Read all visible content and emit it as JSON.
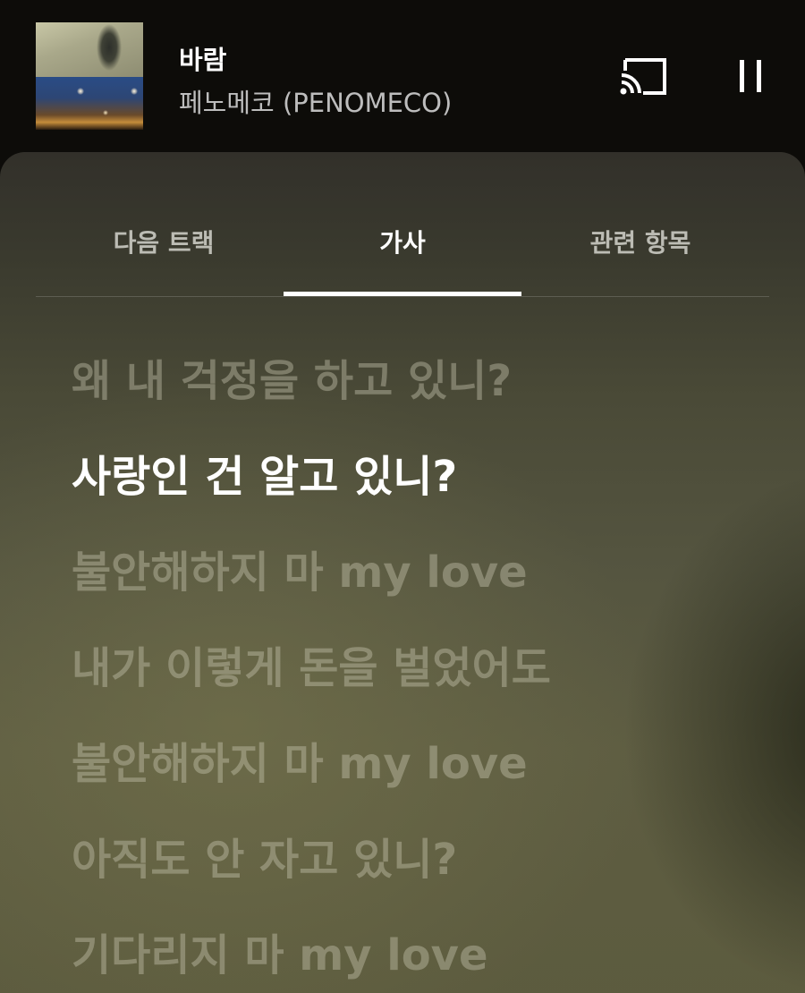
{
  "now_playing": {
    "title": "바람",
    "artist": "페노메코 (PENOMECO)"
  },
  "controls": {
    "cast_icon": "cast-icon",
    "pause_icon": "pause-icon"
  },
  "tabs": [
    {
      "label": "다음 트랙",
      "active": false
    },
    {
      "label": "가사",
      "active": true
    },
    {
      "label": "관련 항목",
      "active": false
    }
  ],
  "lyrics": {
    "current_index": 1,
    "lines": [
      "왜 내 걱정을 하고 있니?",
      "사랑인 건 알고 있니?",
      "불안해하지 마 my love",
      "내가 이렇게 돈을 벌었어도",
      "불안해하지 마 my love",
      "아직도 안 자고 있니?",
      "기다리지 마 my love"
    ]
  },
  "colors": {
    "background": "#0d0c09",
    "active_text": "#ffffff",
    "inactive_lyric": "#c8c6b0"
  }
}
